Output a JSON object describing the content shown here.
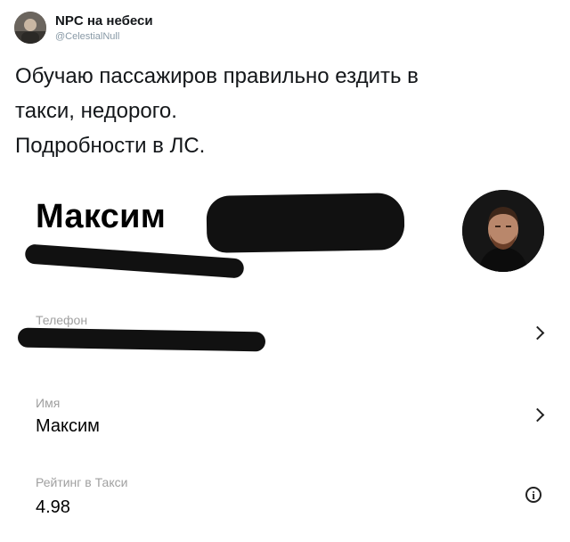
{
  "tweet": {
    "author_name": "NPC на небеси",
    "author_handle": "@CelestialNull",
    "avatar_icon": "user-avatar-icon",
    "text_lines": [
      "Обучаю пассажиров правильно ездить в",
      "такси, недорого.",
      "Подробности в ЛС."
    ]
  },
  "profile": {
    "name": "Максим",
    "photo_icon": "profile-photo-icon",
    "fields": {
      "phone": {
        "label": "Телефон"
      },
      "name": {
        "label": "Имя",
        "value": "Максим"
      },
      "rating": {
        "label": "Рейтинг в Такси",
        "value": "4.98"
      }
    },
    "icons": {
      "phone_action": "chevron-right-icon",
      "name_action": "chevron-right-icon",
      "rating_action": "info-icon"
    },
    "info_glyph": "i"
  }
}
